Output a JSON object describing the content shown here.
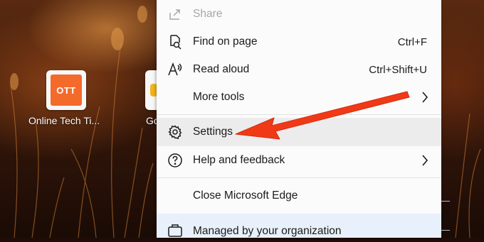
{
  "new_tab": {
    "tiles": [
      {
        "label": "Online Tech Ti...",
        "logo_text": "OTT",
        "color": "#f36a2a"
      },
      {
        "label": "Go",
        "color": "#f2b31b"
      }
    ]
  },
  "menu": {
    "items": [
      {
        "label": "Share",
        "icon": "share-icon",
        "disabled": true
      },
      {
        "label": "Find on page",
        "icon": "find-on-page-icon",
        "shortcut": "Ctrl+F"
      },
      {
        "label": "Read aloud",
        "icon": "read-aloud-icon",
        "shortcut": "Ctrl+Shift+U"
      },
      {
        "label": "More tools",
        "submenu": true
      },
      {
        "label": "Settings",
        "icon": "gear-icon",
        "highlighted": true
      },
      {
        "label": "Help and feedback",
        "icon": "help-icon",
        "submenu": true
      },
      {
        "label": "Close Microsoft Edge"
      },
      {
        "label": "Managed by your organization",
        "icon": "briefcase-icon"
      }
    ]
  },
  "annotation": {
    "type": "arrow",
    "color": "#f03a17",
    "points_to": "Settings"
  }
}
